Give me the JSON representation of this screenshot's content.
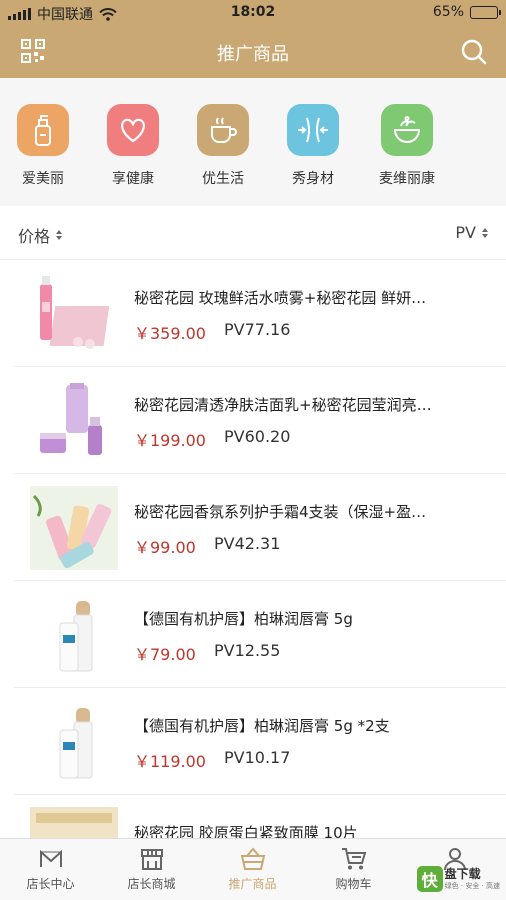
{
  "status": {
    "carrier": "中国联通",
    "time": "18:02",
    "battery": "65%",
    "battery_level": 0.65
  },
  "header": {
    "title": "推广商品"
  },
  "categories": [
    {
      "label": "爱美丽",
      "color": "#eda565"
    },
    {
      "label": "享健康",
      "color": "#f07e7f"
    },
    {
      "label": "优生活",
      "color": "#c9a874"
    },
    {
      "label": "秀身材",
      "color": "#6cc4df"
    },
    {
      "label": "麦维丽康",
      "color": "#7fc972"
    }
  ],
  "sort": {
    "price_label": "价格",
    "pv_label": "PV"
  },
  "products": [
    {
      "name": "秘密花园 玫瑰鲜活水喷雾+秘密花园 鲜妍…",
      "price": "￥359.00",
      "pv": "PV77.16"
    },
    {
      "name": "秘密花园清透净肤洁面乳+秘密花园莹润亮…",
      "price": "￥199.00",
      "pv": "PV60.20"
    },
    {
      "name": "秘密花园香氛系列护手霜4支装（保湿+盈…",
      "price": "￥99.00",
      "pv": "PV42.31"
    },
    {
      "name": "【德国有机护唇】柏琳润唇膏 5g",
      "price": "￥79.00",
      "pv": "PV12.55"
    },
    {
      "name": "【德国有机护唇】柏琳润唇膏 5g *2支",
      "price": "￥119.00",
      "pv": "PV10.17"
    },
    {
      "name": "秘密花园 胶原蛋白紧致面膜 10片",
      "price": "",
      "pv": ""
    }
  ],
  "tabs": [
    {
      "label": "店长中心"
    },
    {
      "label": "店长商城"
    },
    {
      "label": "推广商品"
    },
    {
      "label": "购物车"
    },
    {
      "label": ""
    }
  ],
  "watermark": {
    "logo": "快",
    "title": "盘下载",
    "sub": "绿色 · 安全 · 高速"
  },
  "colors": {
    "brand": "#c9a874",
    "price": "#c0362c"
  }
}
